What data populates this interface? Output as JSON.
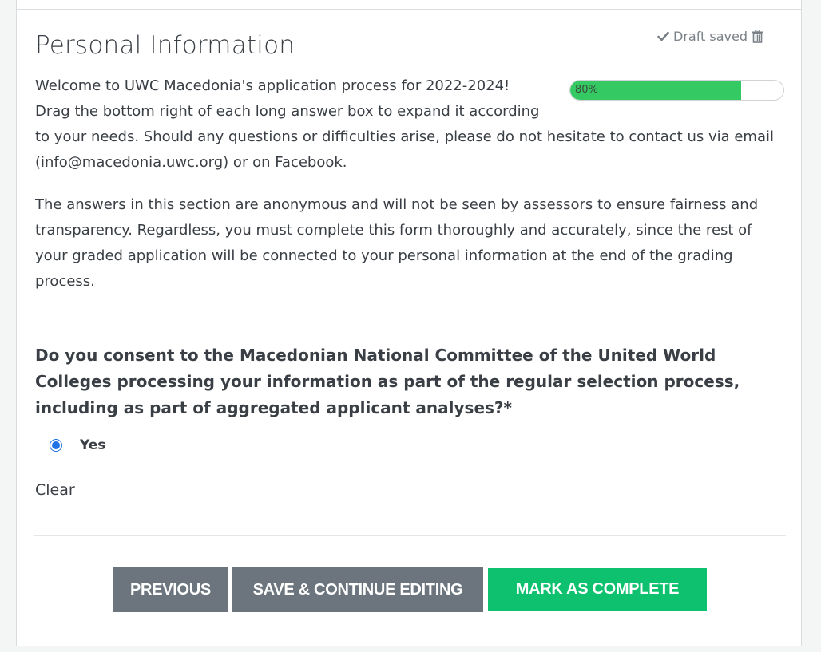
{
  "section": {
    "title": "Personal Information",
    "draft_status": "Draft saved"
  },
  "icons": {
    "draft": "check-icon",
    "delete": "trash-icon"
  },
  "progress": {
    "value_percent": 80,
    "label": "80%",
    "color": "#34c962"
  },
  "intro": {
    "line1": "Welcome to UWC Macedonia's application process for 2022-2024!",
    "line2": "Drag the bottom right of each long answer box to expand it according",
    "rest": "to your needs. Should any questions or difficulties arise, please do not hesitate to contact us via email (info@macedonia.uwc.org) or on Facebook."
  },
  "notice": "The answers in this section are anonymous and will not be seen by assessors to ensure fairness and transparency. Regardless, you must complete this form thoroughly and accurately, since the rest of your graded application will be connected to your personal information at the end of the grading process.",
  "question": {
    "text": "Do you consent to the Macedonian National Committee of the United World Colleges processing your information as part of the regular selection process, including as part of aggregated applicant analyses?*",
    "options": [
      {
        "label": "Yes",
        "selected": true
      }
    ],
    "clear_label": "Clear"
  },
  "actions": {
    "previous": "PREVIOUS",
    "save": "SAVE & CONTINUE EDITING",
    "complete": "MARK AS COMPLETE"
  },
  "colors": {
    "secondary": "#6c757d",
    "success": "#0dc16e",
    "radio": "#1f73e6"
  }
}
